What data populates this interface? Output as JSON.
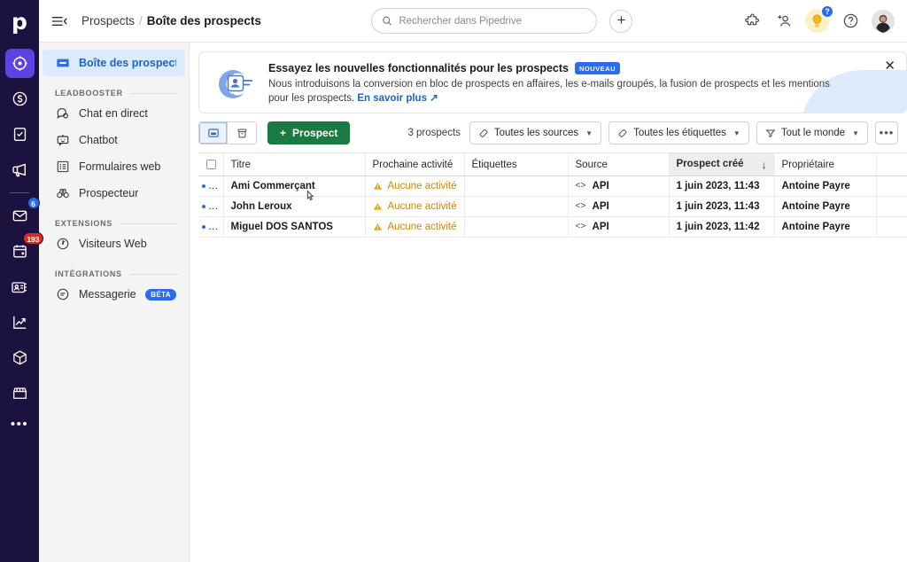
{
  "rail": {
    "logo": "p",
    "items": [
      {
        "name": "leads",
        "icon": "target-icon",
        "active": true
      },
      {
        "name": "deals",
        "icon": "dollar-circle-icon",
        "active": false
      },
      {
        "name": "activities",
        "icon": "clipboard-check-icon",
        "active": false
      },
      {
        "name": "campaigns",
        "icon": "megaphone-icon",
        "active": false
      },
      {
        "name": "mail",
        "icon": "envelope-icon",
        "active": false,
        "badge": "6",
        "badge_color": "#2B6BED"
      },
      {
        "name": "calendar",
        "icon": "calendar-icon",
        "active": false,
        "badge": "193",
        "badge_color": "#E12A1E"
      },
      {
        "name": "contacts",
        "icon": "contact-card-icon",
        "active": false
      },
      {
        "name": "insights",
        "icon": "line-chart-icon",
        "active": false
      },
      {
        "name": "products",
        "icon": "box-icon",
        "active": false
      },
      {
        "name": "marketplace",
        "icon": "storefront-icon",
        "active": false
      }
    ],
    "more_label": "•••"
  },
  "header": {
    "menu_icon": "hamburger-collapse-icon",
    "breadcrumb_parent": "Prospects",
    "breadcrumb_separator": "/",
    "breadcrumb_current": "Boîte des prospects",
    "search_placeholder": "Rechercher dans Pipedrive",
    "search_value": "",
    "add_label": "+",
    "icons": [
      {
        "name": "puzzle-icon",
        "label": "Extensions"
      },
      {
        "name": "add-user-icon",
        "label": "Inviter"
      },
      {
        "name": "lightbulb-icon",
        "label": "Nouveautés"
      },
      {
        "name": "help-circle-icon",
        "label": "Aide"
      }
    ],
    "help_badge": "?"
  },
  "sidebar": {
    "top_item": {
      "label": "Boîte des prospects",
      "icon": "inbox-icon"
    },
    "groups": [
      {
        "title": "LEADBOOSTER",
        "items": [
          {
            "label": "Chat en direct",
            "icon": "chat-bubble-icon"
          },
          {
            "label": "Chatbot",
            "icon": "robot-icon"
          },
          {
            "label": "Formulaires web",
            "icon": "list-form-icon"
          },
          {
            "label": "Prospecteur",
            "icon": "binoculars-icon"
          }
        ]
      },
      {
        "title": "EXTENSIONS",
        "items": [
          {
            "label": "Visiteurs Web",
            "icon": "radar-icon"
          }
        ]
      },
      {
        "title": "INTÉGRATIONS",
        "items": [
          {
            "label": "Messageries",
            "icon": "message-circle-icon",
            "badge": "BÉTA"
          }
        ]
      }
    ]
  },
  "banner": {
    "illustration": "lead-person-target-illustration",
    "title": "Essayez les nouvelles fonctionnalités pour les prospects",
    "tag": "NOUVEAU",
    "body": "Nous introduisons la conversion en bloc de prospects en affaires, les e-mails groupés, la fusion de prospects et les mentions pour les prospects. ",
    "link": "En savoir plus ↗",
    "close_label": "✕"
  },
  "toolbar": {
    "view_inbox_icon": "inbox-view-icon",
    "view_archive_icon": "archive-view-icon",
    "add_prospect_label": "Prospect",
    "add_prospect_plus": "+",
    "count_label": "3 prospects",
    "filters": [
      {
        "label": "Toutes les sources",
        "icon": "tag-icon",
        "caret": "▼"
      },
      {
        "label": "Toutes les étiquettes",
        "icon": "tag-icon",
        "caret": "▼"
      },
      {
        "label": "Tout le monde",
        "icon": "filter-icon",
        "caret": "▼"
      }
    ],
    "overflow_label": "•••"
  },
  "table": {
    "columns": [
      {
        "key": "check",
        "label": ""
      },
      {
        "key": "title",
        "label": "Titre"
      },
      {
        "key": "next_activity",
        "label": "Prochaine activité"
      },
      {
        "key": "labels",
        "label": "Étiquettes"
      },
      {
        "key": "source",
        "label": "Source"
      },
      {
        "key": "created",
        "label": "Prospect créé",
        "sorted": true,
        "sort_arrow": "↓"
      },
      {
        "key": "owner",
        "label": "Propriétaire"
      },
      {
        "key": "blank",
        "label": ""
      },
      {
        "key": "settings",
        "label": "gear-icon"
      }
    ],
    "rows": [
      {
        "title": "Ami Commerçant",
        "next_activity": "Aucune activité",
        "labels": "",
        "source": "API",
        "created": "1 juin 2023, 11:43",
        "owner": "Antoine Payre",
        "row_menu": "•••"
      },
      {
        "title": "John Leroux",
        "next_activity": "Aucune activité",
        "labels": "",
        "source": "API",
        "created": "1 juin 2023, 11:43",
        "owner": "Antoine Payre",
        "row_menu": "•••"
      },
      {
        "title": "Miguel DOS SANTOS",
        "next_activity": "Aucune activité",
        "labels": "",
        "source": "API",
        "created": "1 juin 2023, 11:42",
        "owner": "Antoine Payre",
        "row_menu": "•••"
      }
    ]
  },
  "colors": {
    "rail_bg": "#1C1240",
    "rail_active": "#5C43E2",
    "accent_blue": "#2B6BED",
    "link_blue": "#1F63C8",
    "green_button": "#1A7A41",
    "warning_amber": "#C8860D",
    "badge_red": "#E12A1E",
    "sidebar_bg": "#F4F4F4",
    "sidebar_active_bg": "#DCEBFB"
  }
}
